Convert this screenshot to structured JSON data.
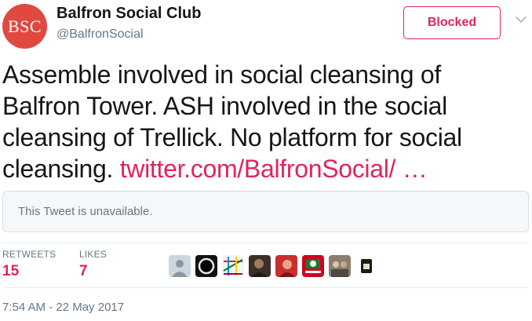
{
  "user": {
    "avatar_text": "BSC",
    "name": "Balfron Social Club",
    "handle": "@BalfronSocial"
  },
  "follow_button": {
    "label": "Blocked"
  },
  "tweet": {
    "text": "Assemble involved in social cleansing of Balfron Tower. ASH involved in the social cleansing of Trellick. No platform for social cleansing. ",
    "link": "twitter.com/BalfronSocial/ …"
  },
  "quoted": {
    "unavailable_text": "This Tweet is unavailable."
  },
  "stats": {
    "retweets_label": "RETWEETS",
    "retweets_value": "15",
    "likes_label": "LIKES",
    "likes_value": "7"
  },
  "likers": [
    {
      "icon": "default-user-icon"
    },
    {
      "icon": "eclipse-ring-icon"
    },
    {
      "icon": "tube-map-icon"
    },
    {
      "icon": "portrait-photo-icon"
    },
    {
      "icon": "red-portrait-icon"
    },
    {
      "icon": "red-poster-icon"
    },
    {
      "icon": "group-photo-icon"
    },
    {
      "icon": "dark-book-icon"
    }
  ],
  "timestamp": "7:54 AM - 22 May 2017",
  "colors": {
    "accent": "#e0245e",
    "avatar_bg": "#e0493f",
    "muted_text": "#657786"
  }
}
